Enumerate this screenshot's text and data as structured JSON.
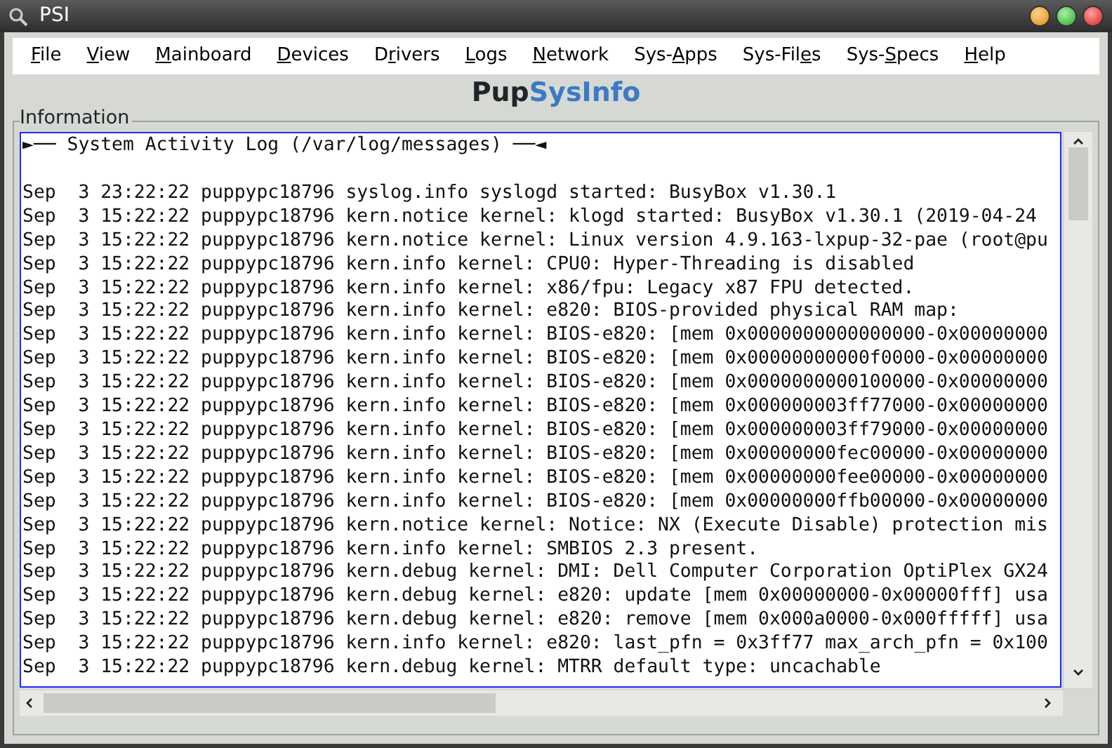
{
  "window": {
    "title": "PSI"
  },
  "menu": [
    {
      "accel": "F",
      "after": "ile"
    },
    {
      "accel": "V",
      "after": "iew"
    },
    {
      "accel": "M",
      "after": "ainboard"
    },
    {
      "accel": "D",
      "after": "evices"
    },
    {
      "before": "D",
      "accel": "r",
      "after": "ivers"
    },
    {
      "accel": "L",
      "after": "ogs"
    },
    {
      "accel": "N",
      "after": "etwork"
    },
    {
      "before": "Sys-",
      "accel": "A",
      "after": "pps"
    },
    {
      "before": "Sys-Fil",
      "accel": "e",
      "after": "s"
    },
    {
      "before": "Sys-",
      "accel": "S",
      "after": "pecs"
    },
    {
      "accel": "H",
      "after": "elp"
    }
  ],
  "brand": {
    "part_1": "Pup",
    "part_2": "SysInfo"
  },
  "frame": {
    "title": "Information"
  },
  "log": {
    "heading": "►── System Activity Log (/var/log/messages) ──◄",
    "lines": [
      "Sep  3 23:22:22 puppypc18796 syslog.info syslogd started: BusyBox v1.30.1",
      "Sep  3 15:22:22 puppypc18796 kern.notice kernel: klogd started: BusyBox v1.30.1 (2019-04-24",
      "Sep  3 15:22:22 puppypc18796 kern.notice kernel: Linux version 4.9.163-lxpup-32-pae (root@pu",
      "Sep  3 15:22:22 puppypc18796 kern.info kernel: CPU0: Hyper-Threading is disabled",
      "Sep  3 15:22:22 puppypc18796 kern.info kernel: x86/fpu: Legacy x87 FPU detected.",
      "Sep  3 15:22:22 puppypc18796 kern.info kernel: e820: BIOS-provided physical RAM map:",
      "Sep  3 15:22:22 puppypc18796 kern.info kernel: BIOS-e820: [mem 0x0000000000000000-0x00000000",
      "Sep  3 15:22:22 puppypc18796 kern.info kernel: BIOS-e820: [mem 0x00000000000f0000-0x00000000",
      "Sep  3 15:22:22 puppypc18796 kern.info kernel: BIOS-e820: [mem 0x0000000000100000-0x00000000",
      "Sep  3 15:22:22 puppypc18796 kern.info kernel: BIOS-e820: [mem 0x000000003ff77000-0x00000000",
      "Sep  3 15:22:22 puppypc18796 kern.info kernel: BIOS-e820: [mem 0x000000003ff79000-0x00000000",
      "Sep  3 15:22:22 puppypc18796 kern.info kernel: BIOS-e820: [mem 0x00000000fec00000-0x00000000",
      "Sep  3 15:22:22 puppypc18796 kern.info kernel: BIOS-e820: [mem 0x00000000fee00000-0x00000000",
      "Sep  3 15:22:22 puppypc18796 kern.info kernel: BIOS-e820: [mem 0x00000000ffb00000-0x00000000",
      "Sep  3 15:22:22 puppypc18796 kern.notice kernel: Notice: NX (Execute Disable) protection mis",
      "Sep  3 15:22:22 puppypc18796 kern.info kernel: SMBIOS 2.3 present.",
      "Sep  3 15:22:22 puppypc18796 kern.debug kernel: DMI: Dell Computer Corporation OptiPlex GX24",
      "Sep  3 15:22:22 puppypc18796 kern.debug kernel: e820: update [mem 0x00000000-0x00000fff] usa",
      "Sep  3 15:22:22 puppypc18796 kern.debug kernel: e820: remove [mem 0x000a0000-0x000fffff] usa",
      "Sep  3 15:22:22 puppypc18796 kern.info kernel: e820: last_pfn = 0x3ff77 max_arch_pfn = 0x100",
      "Sep  3 15:22:22 puppypc18796 kern.debug kernel: MTRR default type: uncachable"
    ]
  }
}
